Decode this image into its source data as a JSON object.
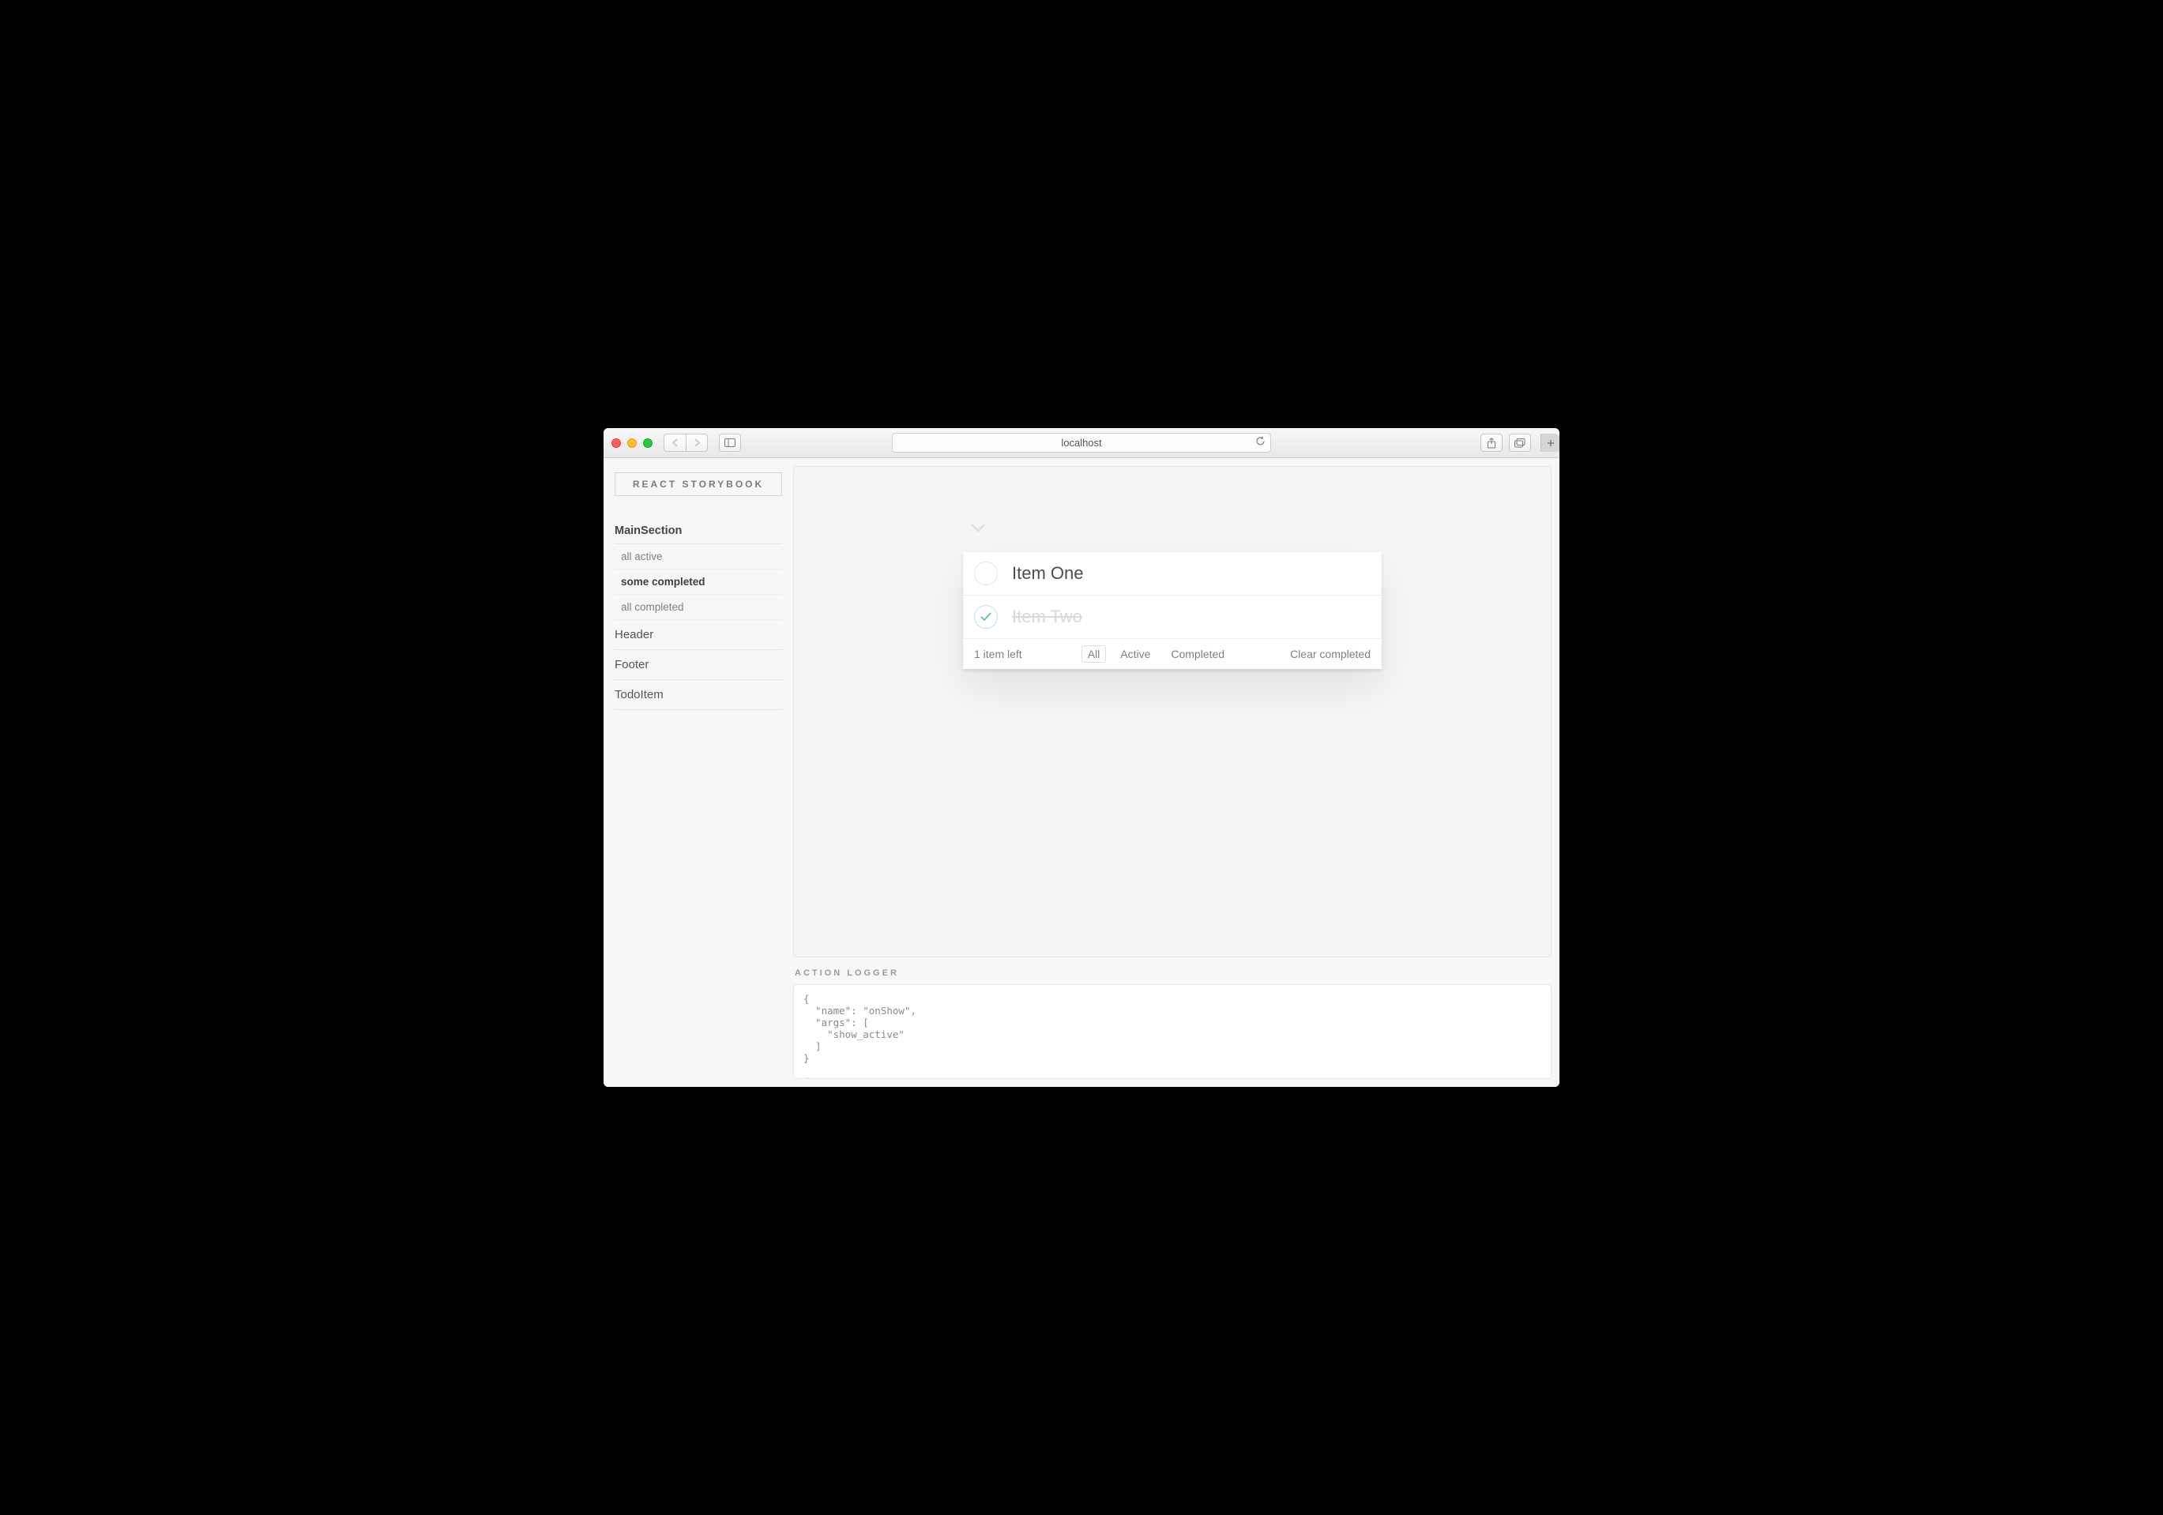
{
  "browser": {
    "address": "localhost"
  },
  "sidebar": {
    "brand": "REACT STORYBOOK",
    "kind": "MainSection",
    "stories": [
      {
        "label": "all active",
        "selected": false
      },
      {
        "label": "some completed",
        "selected": true
      },
      {
        "label": "all completed",
        "selected": false
      }
    ],
    "sections": [
      "Header",
      "Footer",
      "TodoItem"
    ]
  },
  "preview": {
    "items": [
      {
        "label": "Item One",
        "completed": false
      },
      {
        "label": "Item Two",
        "completed": true
      }
    ],
    "footer": {
      "count_text": "1 item left",
      "filters": {
        "all": "All",
        "active": "Active",
        "completed": "Completed"
      },
      "selected_filter": "all",
      "clear": "Clear completed"
    }
  },
  "logger": {
    "title": "ACTION LOGGER",
    "content": "{\n  \"name\": \"onShow\",\n  \"args\": [\n    \"show_active\"\n  ]\n}\n\n{"
  }
}
